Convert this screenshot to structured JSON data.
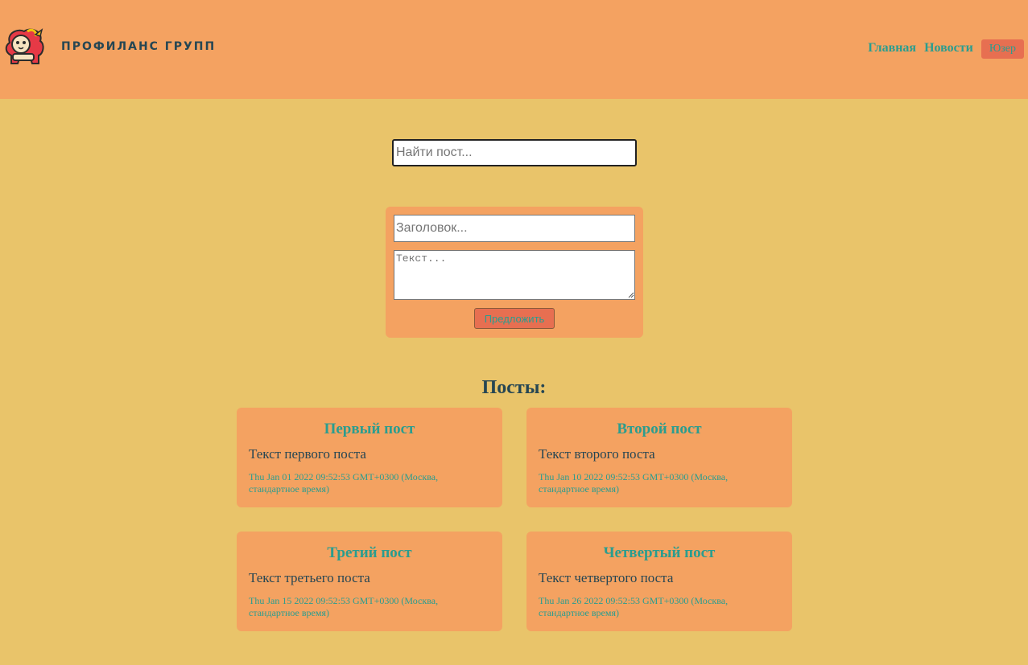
{
  "header": {
    "brand": "ПРОФИЛАНС ГРУПП",
    "nav": {
      "home": "Главная",
      "news": "Новости",
      "user": "Юзер"
    }
  },
  "search": {
    "placeholder": "Найти пост..."
  },
  "form": {
    "title_placeholder": "Заголовок...",
    "text_placeholder": "Текст...",
    "submit_label": "Предложить"
  },
  "posts_heading": "Посты:",
  "posts": [
    {
      "title": "Первый пост",
      "body": "Текст первого поста",
      "date": "Thu Jan 01 2022 09:52:53 GMT+0300 (Москва, стандартное время)"
    },
    {
      "title": "Второй пост",
      "body": "Текст второго поста",
      "date": "Thu Jan 10 2022 09:52:53 GMT+0300 (Москва, стандартное время)"
    },
    {
      "title": "Третий пост",
      "body": "Текст третьего поста",
      "date": "Thu Jan 15 2022 09:52:53 GMT+0300 (Москва, стандартное время)"
    },
    {
      "title": "Четвертый пост",
      "body": "Текст четвертого поста",
      "date": "Thu Jan 26 2022 09:52:53 GMT+0300 (Москва, стандартное время)"
    }
  ],
  "colors": {
    "background": "#e9c46a",
    "panel": "#f4a261",
    "accent": "#2a9d8f",
    "button": "#e76f51",
    "text": "#264653"
  },
  "icons": {
    "logo": "lion-logo-icon"
  }
}
